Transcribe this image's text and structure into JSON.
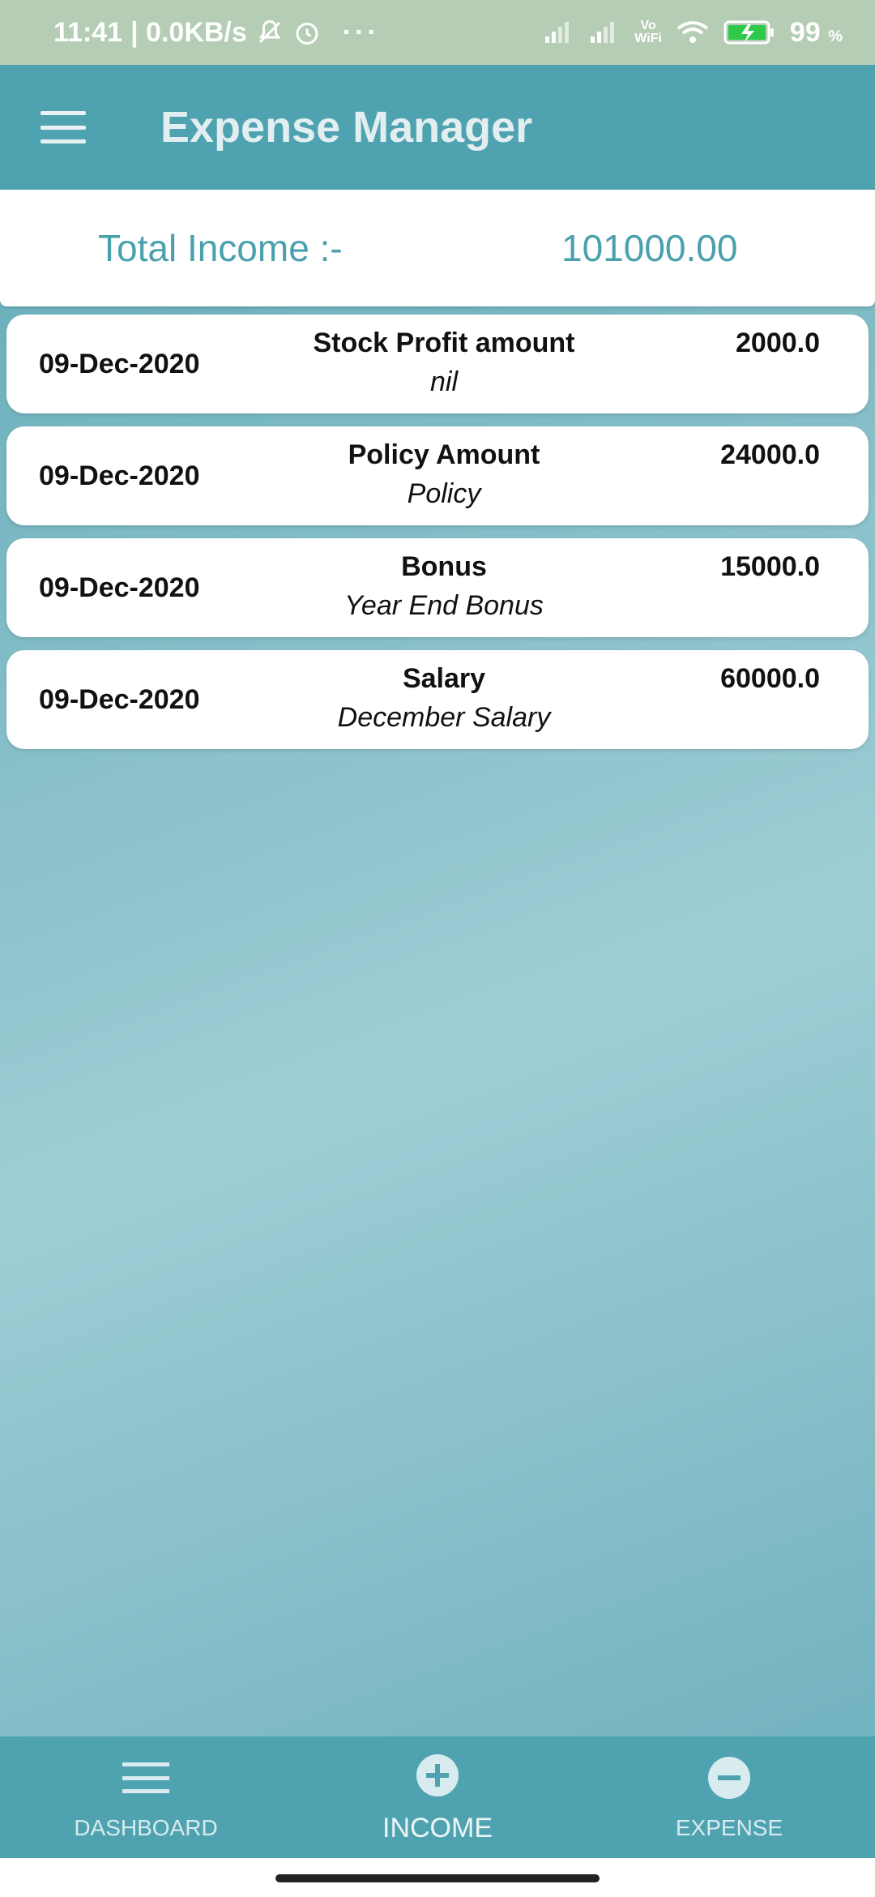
{
  "status_bar": {
    "time": "11:41",
    "network_speed": "| 0.0KB/s",
    "more_indicator": "···",
    "battery_percent": "99",
    "battery_unit": "%",
    "wifi_label_top": "Vo",
    "wifi_label_bottom": "WiFi",
    "icons": [
      "mute-icon",
      "alarm-icon",
      "signal-icon",
      "signal-icon",
      "wifi-icon",
      "battery-charging-icon"
    ]
  },
  "app_bar": {
    "title": "Expense Manager",
    "menu_icon": "hamburger-menu-icon"
  },
  "summary": {
    "label": "Total Income :-",
    "value": "101000.00"
  },
  "entries": [
    {
      "date": "09-Dec-2020",
      "title": "Stock Profit amount",
      "note": "nil",
      "amount": "2000.0"
    },
    {
      "date": "09-Dec-2020",
      "title": "Policy Amount",
      "note": "Policy",
      "amount": "24000.0"
    },
    {
      "date": "09-Dec-2020",
      "title": "Bonus",
      "note": "Year End Bonus",
      "amount": "15000.0"
    },
    {
      "date": "09-Dec-2020",
      "title": "Salary",
      "note": "December Salary",
      "amount": "60000.0"
    }
  ],
  "bottom_nav": {
    "items": [
      {
        "label": "DASHBOARD",
        "icon": "list-icon"
      },
      {
        "label": "INCOME",
        "icon": "plus-circle-icon",
        "active": true
      },
      {
        "label": "EXPENSE",
        "icon": "minus-circle-icon"
      }
    ]
  },
  "colors": {
    "primary": "#4fa3b0",
    "status_bar": "#b4cdb4",
    "accent_text": "#4aa0ad",
    "card": "#ffffff"
  }
}
